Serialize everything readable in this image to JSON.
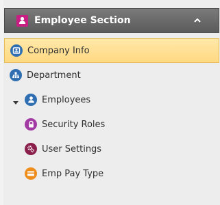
{
  "section": {
    "title": "Employee Section",
    "header_icon": "user-badge-icon",
    "collapse_icon": "chevron-up-icon",
    "color": "#c81d83"
  },
  "items": [
    {
      "label": "Company Info",
      "icon": "id-card-icon",
      "icon_color": "#2f6fb1",
      "selected": true
    },
    {
      "label": "Department",
      "icon": "org-chart-icon",
      "icon_color": "#2f6fb1"
    },
    {
      "label": "Employees",
      "icon": "person-icon",
      "icon_color": "#2f6fb1",
      "expanded": true
    },
    {
      "label": "Security Roles",
      "icon": "lock-icon",
      "icon_color": "#a23aa4"
    },
    {
      "label": "User Settings",
      "icon": "gears-icon",
      "icon_color": "#8a1f4b"
    },
    {
      "label": "Emp Pay Type",
      "icon": "pay-card-icon",
      "icon_color": "#ee8d1c"
    }
  ],
  "colors": {
    "selection_bg": "#ffd983",
    "header_bg": "#6b6b6b"
  }
}
